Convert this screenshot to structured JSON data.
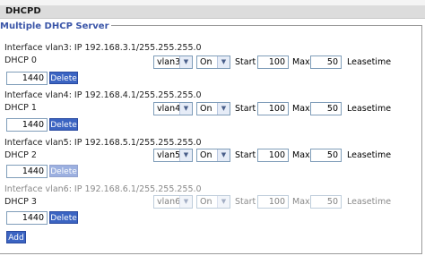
{
  "header": {
    "title": "DHCPD"
  },
  "section": {
    "legend": "Multiple DHCP Server"
  },
  "labels": {
    "start": "Start",
    "max": "Max",
    "leasetime": "Leasetime"
  },
  "entries": [
    {
      "interface_label": "Interface vlan3: IP 192.168.3.1/255.255.255.0",
      "dhcp_label": "DHCP 0",
      "vlan": "vlan3",
      "onoff": "On",
      "start": "100",
      "max": "50",
      "leasetime": "1440",
      "delete_label": "Delete"
    },
    {
      "interface_label": "Interface vlan4: IP 192.168.4.1/255.255.255.0",
      "dhcp_label": "DHCP 1",
      "vlan": "vlan4",
      "onoff": "On",
      "start": "100",
      "max": "50",
      "leasetime": "1440",
      "delete_label": "Delete"
    },
    {
      "interface_label": "Interface vlan5: IP 192.168.5.1/255.255.255.0",
      "dhcp_label": "DHCP 2",
      "vlan": "vlan5",
      "onoff": "On",
      "start": "100",
      "max": "50",
      "leasetime": "1440",
      "delete_label": "Delete"
    },
    {
      "interface_label": "Interface vlan6: IP 192.168.6.1/255.255.255.0",
      "dhcp_label": "DHCP 3",
      "vlan": "vlan6",
      "onoff": "On",
      "start": "100",
      "max": "50",
      "leasetime": "1440",
      "delete_label": "Delete"
    }
  ],
  "add_label": "Add"
}
